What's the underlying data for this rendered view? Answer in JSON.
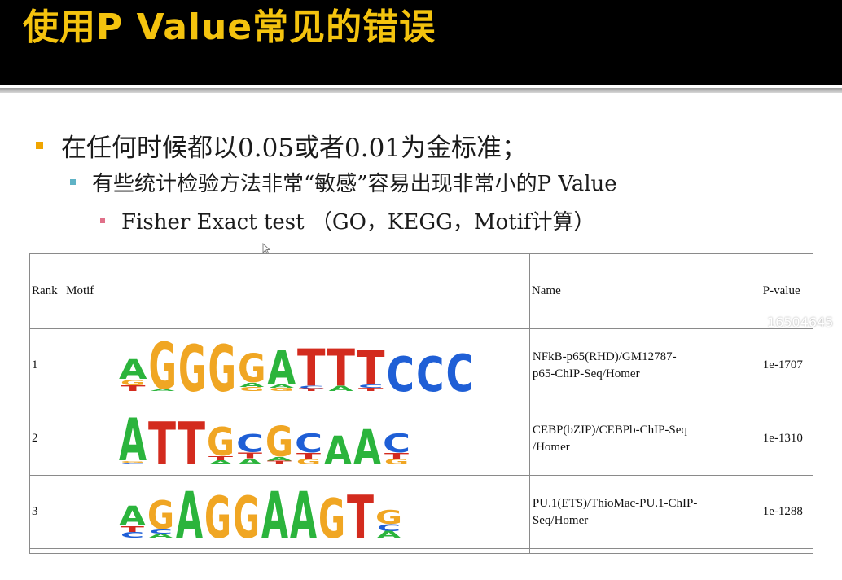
{
  "slide": {
    "title": "使用P Value常见的错误",
    "bullets": {
      "level1": "在任何时候都以0.05或者0.01为金标准；",
      "level2": "有些统计检验方法非常“敏感”容易出现非常小的P Value",
      "level3": "Fisher Exact test （GO，KEGG，Motif计算）"
    }
  },
  "table": {
    "headers": {
      "rank": "Rank",
      "motif": "Motif",
      "name": "Name",
      "pvalue": "P-value"
    },
    "rows": [
      {
        "rank": "1",
        "name_line1": "NFkB-p65(RHD)/GM12787-",
        "name_line2": "p65-ChIP-Seq/Homer",
        "pvalue": "1e-1707",
        "logo": "AGGGGATTTCCC"
      },
      {
        "rank": "2",
        "name_line1": "CEBP(bZIP)/CEBPb-ChIP-Seq",
        "name_line2": "/Homer",
        "pvalue": "1e-1310",
        "logo": "ATTGCGCAAC"
      },
      {
        "rank": "3",
        "name_line1": "PU.1(ETS)/ThioMac-PU.1-ChIP-",
        "name_line2": "Seq/Homer",
        "pvalue": "1e-1288",
        "logo": "AGAGGAAGTG"
      }
    ]
  },
  "watermark": "16504645",
  "colors": {
    "title": "#f4c30e",
    "A": "#2bb43c",
    "C": "#1f5fd6",
    "G": "#f0a623",
    "T": "#d32b1e"
  },
  "icons": {
    "cursor": "mouse-pointer-icon"
  }
}
